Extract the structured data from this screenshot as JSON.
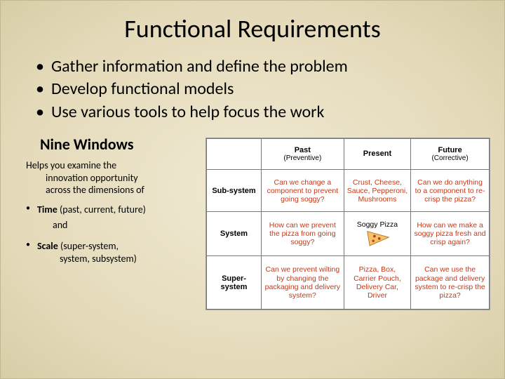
{
  "title": "Functional Requirements",
  "main_bullets": [
    "Gather information and define the problem",
    "Develop functional models",
    "Use various tools to help focus the work"
  ],
  "section": {
    "heading": "Nine Windows",
    "lead_line1": "Helps you examine the",
    "lead_line2": "innovation opportunity",
    "lead_line3": "across the dimensions of",
    "bullets": [
      {
        "dim": "Time",
        "paren": " (past, current, future)"
      },
      {
        "and": "and"
      },
      {
        "dim": "Scale",
        "paren": " (super-system,",
        "line2": "system, subsystem)"
      }
    ]
  },
  "table": {
    "col_headers": [
      {
        "main": "Past",
        "sub": "(Preventive)"
      },
      {
        "main": "Present",
        "sub": ""
      },
      {
        "main": "Future",
        "sub": "(Corrective)"
      }
    ],
    "row_headers": [
      "Sub-system",
      "System",
      "Super-system"
    ],
    "cells": [
      [
        "Can we change a component to prevent going soggy?",
        "Crust, Cheese, Sauce, Pepperoni, Mushrooms",
        "Can we do anything to a component to re-crisp the pizza?"
      ],
      [
        "How can we prevent the pizza from going soggy?",
        "Soggy Pizza",
        "How can we make a soggy pizza fresh and crisp again?"
      ],
      [
        "Can we prevent wilting by changing the packaging and delivery system?",
        "Pizza, Box, Carrier Pouch, Delivery Car, Driver",
        "Can we use the package and delivery system to re-crisp the pizza?"
      ]
    ]
  }
}
